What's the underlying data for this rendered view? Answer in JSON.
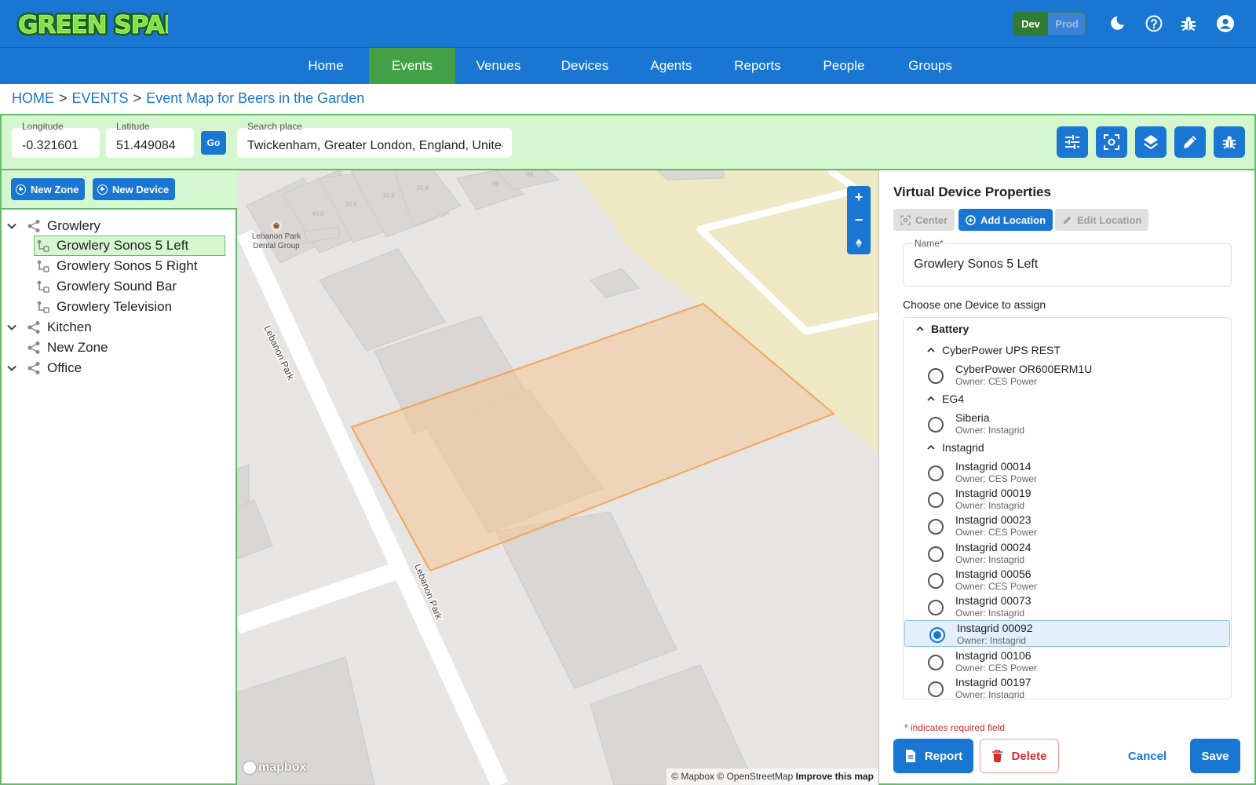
{
  "app": {
    "logo_text": "GREEN SPARKS",
    "env": {
      "dev_label": "Dev",
      "prod_label": "Prod",
      "selected": "Dev"
    },
    "header_icons": [
      "moon-icon",
      "help-icon",
      "bug-icon",
      "account-icon"
    ],
    "colors": {
      "primary": "#1976d2",
      "accent": "#43a047",
      "panel_bg": "#d4f7cf",
      "danger": "#d32f2f",
      "zone_fill": "#f5c68f"
    }
  },
  "nav": {
    "items": [
      {
        "label": "Home"
      },
      {
        "label": "Events",
        "active": true
      },
      {
        "label": "Venues"
      },
      {
        "label": "Devices"
      },
      {
        "label": "Agents"
      },
      {
        "label": "Reports"
      },
      {
        "label": "People"
      },
      {
        "label": "Groups"
      }
    ]
  },
  "breadcrumb": {
    "items": [
      "HOME",
      "EVENTS",
      "Event Map for Beers in the Garden"
    ],
    "separator": ">"
  },
  "toolbar": {
    "longitude": {
      "label": "Longitude",
      "value": "-0.321601"
    },
    "latitude": {
      "label": "Latitude",
      "value": "51.449084"
    },
    "go_label": "Go",
    "search": {
      "label": "Search place",
      "value": "Twickenham, Greater London, England, United Kingdom"
    },
    "tools": [
      "sliders-icon",
      "focus-icon",
      "layers-icon",
      "pencil-icon",
      "bug-icon"
    ]
  },
  "tree": {
    "new_zone_label": "New Zone",
    "new_device_label": "New Device",
    "nodes": [
      {
        "label": "Growlery",
        "type": "zone",
        "expanded": true
      },
      {
        "label": "Growlery Sonos 5 Left",
        "type": "device",
        "selected": true
      },
      {
        "label": "Growlery Sonos 5 Right",
        "type": "device"
      },
      {
        "label": "Growlery Sound Bar",
        "type": "device"
      },
      {
        "label": "Growlery Television",
        "type": "device"
      },
      {
        "label": "Kitchen",
        "type": "zone",
        "expanded": true
      },
      {
        "label": "New Zone",
        "type": "zone"
      },
      {
        "label": "Office",
        "type": "zone",
        "expanded": true
      }
    ]
  },
  "map": {
    "poi": [
      "Lebanon Park",
      "Dental Group"
    ],
    "road_label": "Lebanon Park",
    "house_numbers": [
      "44,8",
      "34,8",
      "34,8",
      "34,8",
      "86",
      "86"
    ],
    "zoom_in": "+",
    "zoom_out": "−",
    "logo": "mapbox",
    "attribution": {
      "text": "© Mapbox © OpenStreetMap",
      "link": "Improve this map"
    }
  },
  "properties": {
    "title": "Virtual Device Properties",
    "center_label": "Center",
    "add_location_label": "Add Location",
    "edit_location_label": "Edit Location",
    "name_label": "Name",
    "required_mark": "*",
    "name_value": "Growlery Sonos 5 Left",
    "assign_label": "Choose one Device to assign",
    "groups": [
      {
        "label": "Battery",
        "level": 0
      },
      {
        "label": "CyberPower UPS REST",
        "level": 1
      },
      {
        "label": "EG4",
        "level": 1
      },
      {
        "label": "Instagrid",
        "level": 1
      }
    ],
    "devices": [
      {
        "name": "CyberPower OR600ERM1U",
        "owner": "Owner: CES Power"
      },
      {
        "name": "Siberia",
        "owner": "Owner: Instagrid"
      },
      {
        "name": "Instagrid 00014",
        "owner": "Owner: CES Power"
      },
      {
        "name": "Instagrid 00019",
        "owner": "Owner: Instagrid"
      },
      {
        "name": "Instagrid 00023",
        "owner": "Owner: CES Power"
      },
      {
        "name": "Instagrid 00024",
        "owner": "Owner: Instagrid"
      },
      {
        "name": "Instagrid 00056",
        "owner": "Owner: CES Power"
      },
      {
        "name": "Instagrid 00073",
        "owner": "Owner: Instagrid"
      },
      {
        "name": "Instagrid 00092",
        "owner": "Owner: Instagrid",
        "selected": true
      },
      {
        "name": "Instagrid 00106",
        "owner": "Owner: CES Power"
      },
      {
        "name": "Instagrid 00197",
        "owner": "Owner: Instagrid"
      }
    ],
    "required_note": "* indicates required field",
    "report_label": "Report",
    "delete_label": "Delete",
    "cancel_label": "Cancel",
    "save_label": "Save"
  }
}
